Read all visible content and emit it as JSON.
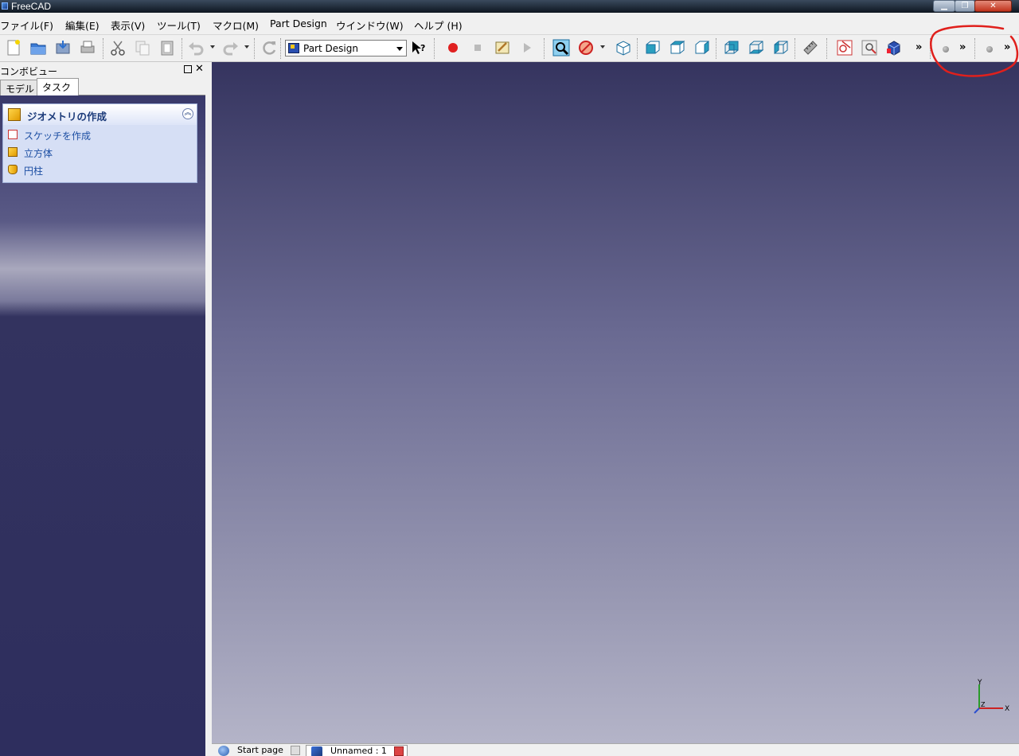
{
  "window": {
    "title": "FreeCAD",
    "controls": [
      "minimize",
      "maximize",
      "close"
    ]
  },
  "menu": {
    "items": [
      "ファイル(F)",
      "編集(E)",
      "表示(V)",
      "ツール(T)",
      "マクロ(M)",
      "Part Design",
      "ウインドウ(W)",
      "ヘルプ (H)"
    ]
  },
  "toolbar": {
    "workbench_selected": "Part Design",
    "icons": [
      "new-icon",
      "open-icon",
      "save-icon",
      "print-icon",
      "cut-icon",
      "copy-icon",
      "paste-icon",
      "undo-icon",
      "redo-icon",
      "refresh-icon",
      "whats-this-icon",
      "macro-record-icon",
      "macro-stop-icon",
      "macro-edit-icon",
      "macro-run-icon",
      "fit-all-icon",
      "draw-style-icon",
      "axonometric-icon",
      "front-view-icon",
      "top-view-icon",
      "right-view-icon",
      "rear-view-icon",
      "bottom-view-icon",
      "left-view-icon",
      "measure-icon",
      "sketch-icon",
      "view-sketch-icon",
      "pad-icon"
    ],
    "overflow_label": "»"
  },
  "combo_view": {
    "title": "コンボビュー",
    "tabs": [
      "モデル",
      "タスク"
    ],
    "active_tab": "タスク",
    "panel": {
      "title": "ジオメトリの作成",
      "collapse_icon": "chevron-up-icon",
      "tasks": [
        {
          "label": "スケッチを作成",
          "icon": "sketch-icon"
        },
        {
          "label": "立方体",
          "icon": "cube-icon"
        },
        {
          "label": "円柱",
          "icon": "cylinder-icon"
        }
      ]
    }
  },
  "viewport": {
    "axis_labels": {
      "x": "X",
      "y": "Y",
      "z": "Z"
    },
    "colors": {
      "top": "#35345f",
      "bottom": "#b4b4c8"
    }
  },
  "doc_tabs": [
    "Start page",
    "Unnamed : 1"
  ],
  "annotation": {
    "color": "#e0201c",
    "shape": "freehand-circle"
  }
}
